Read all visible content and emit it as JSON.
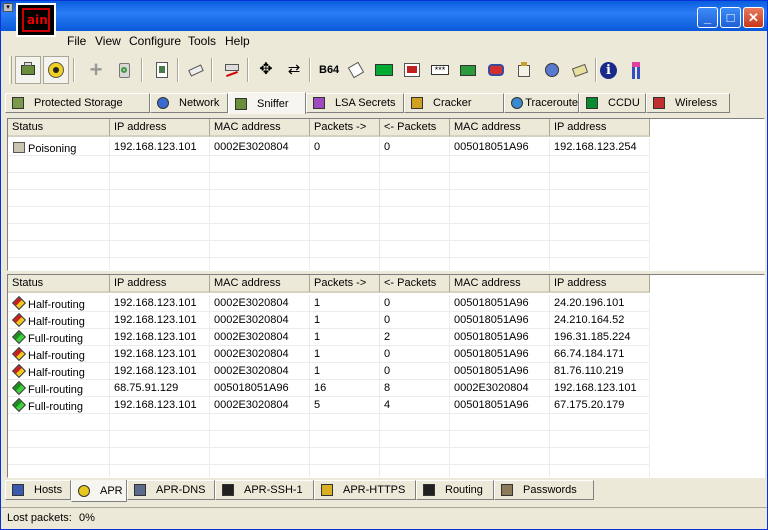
{
  "window": {
    "logo_text": "ain",
    "sysmenu_glyph": "▾"
  },
  "menu": [
    "File",
    "View",
    "Configure",
    "Tools",
    "Help"
  ],
  "toolbar": {
    "b64_label": "B64"
  },
  "top_tabs": [
    {
      "label": "Protected Storage",
      "icon": "protected-storage-icon"
    },
    {
      "label": "Network",
      "icon": "network-globe-icon"
    },
    {
      "label": "Sniffer",
      "icon": "sniffer-icon",
      "active": true
    },
    {
      "label": "LSA Secrets",
      "icon": "lsa-secrets-icon"
    },
    {
      "label": "Cracker",
      "icon": "cracker-key-icon"
    },
    {
      "label": "Traceroute",
      "icon": "traceroute-icon"
    },
    {
      "label": "CCDU",
      "icon": "ccdu-icon"
    },
    {
      "label": "Wireless",
      "icon": "wireless-icon"
    }
  ],
  "columns": [
    "Status",
    "IP address",
    "MAC address",
    "Packets ->",
    "<- Packets",
    "MAC address",
    "IP address"
  ],
  "upper_rows": [
    [
      "Poisoning",
      "192.168.123.101",
      "0002E3020804",
      "0",
      "0",
      "005018051A96",
      "192.168.123.254"
    ]
  ],
  "lower_rows": [
    [
      "Half-routing",
      "192.168.123.101",
      "0002E3020804",
      "1",
      "0",
      "005018051A96",
      "24.20.196.101"
    ],
    [
      "Half-routing",
      "192.168.123.101",
      "0002E3020804",
      "1",
      "0",
      "005018051A96",
      "24.210.164.52"
    ],
    [
      "Full-routing",
      "192.168.123.101",
      "0002E3020804",
      "1",
      "2",
      "005018051A96",
      "196.31.185.224"
    ],
    [
      "Half-routing",
      "192.168.123.101",
      "0002E3020804",
      "1",
      "0",
      "005018051A96",
      "66.74.184.171"
    ],
    [
      "Half-routing",
      "192.168.123.101",
      "0002E3020804",
      "1",
      "0",
      "005018051A96",
      "81.76.110.219"
    ],
    [
      "Full-routing",
      "68.75.91.129",
      "005018051A96",
      "16",
      "8",
      "0002E3020804",
      "192.168.123.101"
    ],
    [
      "Full-routing",
      "192.168.123.101",
      "0002E3020804",
      "5",
      "4",
      "005018051A96",
      "67.175.20.179"
    ]
  ],
  "bottom_tabs": [
    {
      "label": "Hosts",
      "icon": "hosts-computer-icon"
    },
    {
      "label": "APR",
      "icon": "apr-radiation-icon",
      "active": true
    },
    {
      "label": "APR-DNS",
      "icon": "apr-dns-icon"
    },
    {
      "label": "APR-SSH-1",
      "icon": "apr-ssh-terminal-icon"
    },
    {
      "label": "APR-HTTPS",
      "icon": "apr-https-lock-icon"
    },
    {
      "label": "Routing",
      "icon": "routing-arrows-icon"
    },
    {
      "label": "Passwords",
      "icon": "passwords-icon"
    }
  ],
  "status": {
    "label": "Lost packets:",
    "value": "0%"
  }
}
